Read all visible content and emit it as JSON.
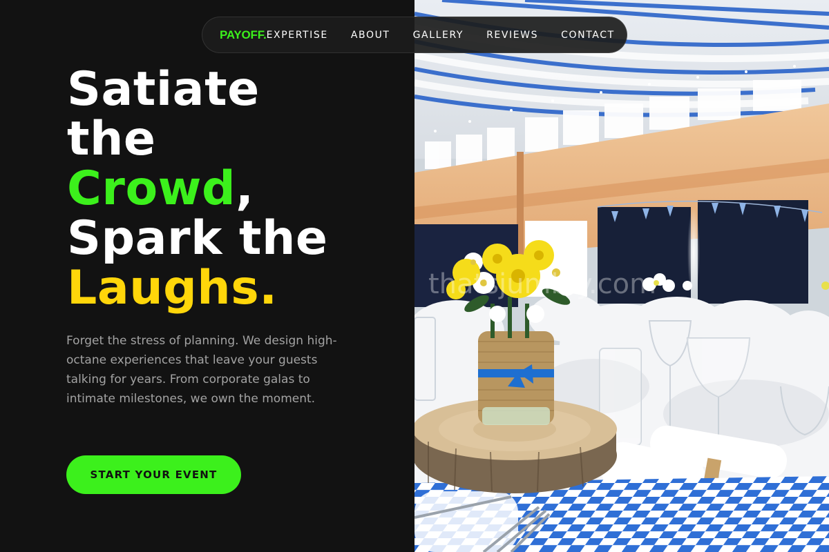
{
  "nav": {
    "logo": "PAYOFF.",
    "items": [
      {
        "label": "EXPERTISE"
      },
      {
        "label": "ABOUT"
      },
      {
        "label": "GALLERY"
      },
      {
        "label": "REVIEWS"
      },
      {
        "label": "CONTACT"
      }
    ]
  },
  "hero": {
    "line1": "Satiate",
    "line2": "the",
    "line3_highlight": "Crowd",
    "line3_rest": ",",
    "line4": "Spark the",
    "line5": "Laughs.",
    "description": "Forget the stress of planning. We design high-octane experiences that leave your guests talking for years. From corporate galas to intimate milestones, we own the moment.",
    "cta": "START YOUR EVENT"
  },
  "image": {
    "subject": "event-hall-table-setting",
    "watermark": "thatsjumbly.com"
  },
  "colors": {
    "background": "#121212",
    "accent_green": "#3cf01c",
    "accent_yellow": "#ffd60a",
    "text_muted": "#a3a3a3"
  }
}
